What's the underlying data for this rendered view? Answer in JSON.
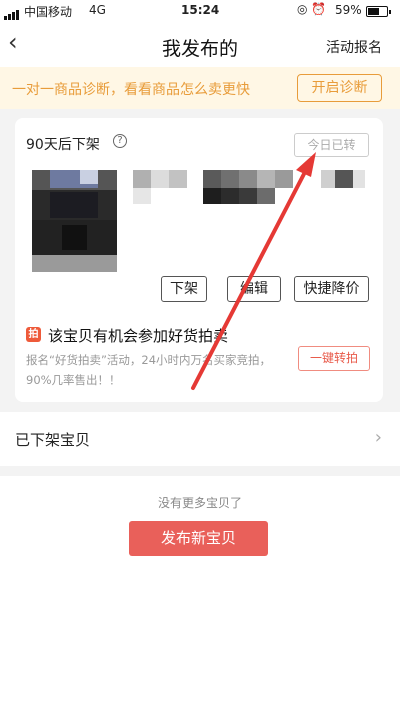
{
  "status_bar": {
    "carrier": "中国移动",
    "network": "4G",
    "time": "15:24",
    "battery_percent": "59%",
    "battery_level": 0.59
  },
  "nav": {
    "title": "我发布的",
    "right_link": "活动报名",
    "back_icon": "chevron-left-icon"
  },
  "banner": {
    "text": "一对一商品诊断，看看商品怎么卖更快",
    "button": "开启诊断"
  },
  "item_card": {
    "delist_note": "90天后下架",
    "today_button": "今日已转",
    "actions": [
      "下架",
      "编辑",
      "快捷降价"
    ],
    "promo": {
      "title": "该宝贝有机会参加好货拍卖",
      "description": "报名“好货拍卖”活动，24小时内万名买家竞拍，90%几率售出！！",
      "button": "一键转拍"
    }
  },
  "delisted_section": {
    "label": "已下架宝贝"
  },
  "footer": {
    "no_more": "没有更多宝贝了",
    "publish_button": "发布新宝贝"
  },
  "colors": {
    "accent_orange": "#e89c3a",
    "banner_bg": "#fff7e5",
    "primary_red": "#e9605a",
    "arrow_red": "#e53935"
  }
}
